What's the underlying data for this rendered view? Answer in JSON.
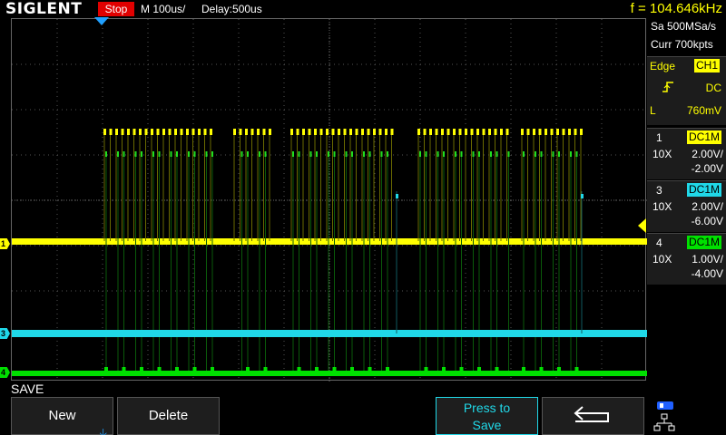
{
  "topbar": {
    "brand": "SIGLENT",
    "run_state": "Stop",
    "timebase": "M 100us/",
    "delay": "Delay:500us",
    "frequency": "f = 104.646kHz"
  },
  "acquisition": {
    "sample_rate": "Sa 500MSa/s",
    "memory_depth": "Curr 700kpts"
  },
  "trigger": {
    "type": "Edge",
    "source": "CH1",
    "slope_icon": "rising-edge-icon",
    "coupling": "DC",
    "level_label": "L",
    "level": "760mV"
  },
  "channels": [
    {
      "num": "1",
      "coupling": "DC1M",
      "probe": "10X",
      "scale": "2.00V/",
      "offset": "-2.00V",
      "color": "#ffff00"
    },
    {
      "num": "3",
      "coupling": "DC1M",
      "probe": "10X",
      "scale": "2.00V/",
      "offset": "-6.00V",
      "color": "#20d8e8"
    },
    {
      "num": "4",
      "coupling": "DC1M",
      "probe": "10X",
      "scale": "1.00V/",
      "offset": "-4.00V",
      "color": "#00e000"
    }
  ],
  "menu": {
    "title": "SAVE",
    "new_label": "New",
    "delete_label": "Delete",
    "press_save_line1": "Press to",
    "press_save_line2": "Save",
    "back_icon": "return-arrow-icon"
  },
  "markers": {
    "ch1": "1",
    "ch3": "3",
    "ch4": "4"
  },
  "status": {
    "icons": [
      "usb-icon",
      "network-icon"
    ]
  }
}
